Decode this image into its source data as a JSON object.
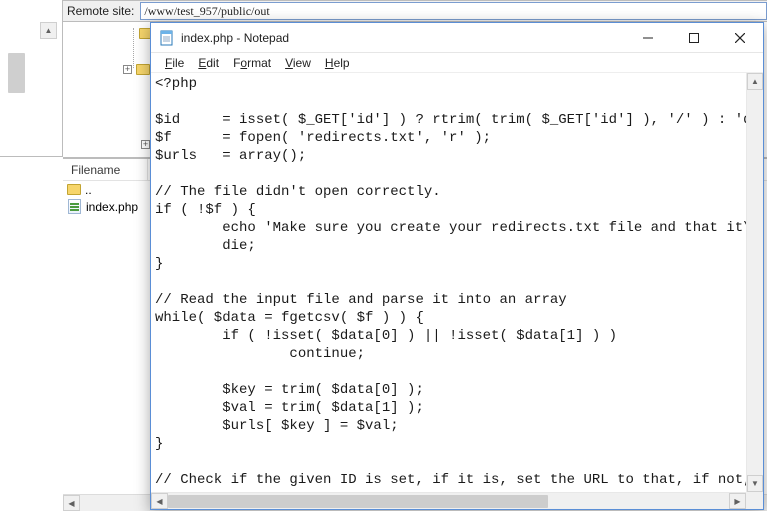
{
  "ftp": {
    "remote_label": "Remote site:",
    "remote_path": "/www/test_957/public/out",
    "filename_header": "Filename",
    "rows": [
      {
        "name": "..",
        "type": "updir"
      },
      {
        "name": "index.php",
        "type": "php"
      }
    ]
  },
  "notepad": {
    "title": "index.php - Notepad",
    "menus": {
      "file": {
        "label": "File",
        "hotkey": "F"
      },
      "edit": {
        "label": "Edit",
        "hotkey": "E"
      },
      "format": {
        "label": "Format",
        "hotkey": "o"
      },
      "view": {
        "label": "View",
        "hotkey": "V"
      },
      "help": {
        "label": "Help",
        "hotkey": "H"
      }
    },
    "content": "<?php\n\n$id     = isset( $_GET['id'] ) ? rtrim( trim( $_GET['id'] ), '/' ) : 'defa\n$f      = fopen( 'redirects.txt', 'r' );\n$urls   = array();\n\n// The file didn't open correctly.\nif ( !$f ) {\n        echo 'Make sure you create your redirects.txt file and that it\\'s \n        die;\n}\n\n// Read the input file and parse it into an array\nwhile( $data = fgetcsv( $f ) ) {\n        if ( !isset( $data[0] ) || !isset( $data[1] ) )\n                continue;\n\n        $key = trim( $data[0] );\n        $val = trim( $data[1] );\n        $urls[ $key ] = $val;\n}\n\n// Check if the given ID is set, if it is, set the URL to that, if not, de  s"
  }
}
